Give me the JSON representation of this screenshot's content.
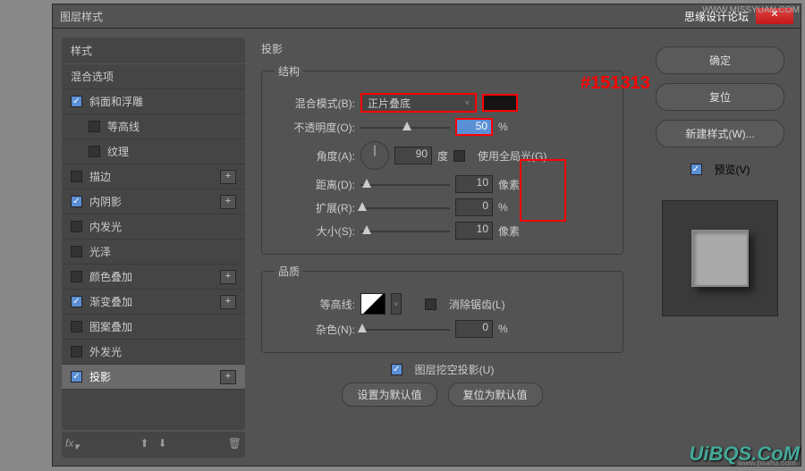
{
  "dialog": {
    "title": "图层样式",
    "tag_text": "思缘设计论坛"
  },
  "sidebar": {
    "header": "样式",
    "blend_options": "混合选项",
    "items": [
      {
        "label": "斜面和浮雕",
        "checked": true,
        "plus": false
      },
      {
        "label": "等高线",
        "checked": false,
        "sub": true
      },
      {
        "label": "纹理",
        "checked": false,
        "sub": true
      },
      {
        "label": "描边",
        "checked": false,
        "plus": true
      },
      {
        "label": "内阴影",
        "checked": true,
        "plus": true
      },
      {
        "label": "内发光",
        "checked": false
      },
      {
        "label": "光泽",
        "checked": false
      },
      {
        "label": "颜色叠加",
        "checked": false,
        "plus": true
      },
      {
        "label": "渐变叠加",
        "checked": true,
        "plus": true
      },
      {
        "label": "图案叠加",
        "checked": false
      },
      {
        "label": "外发光",
        "checked": false
      },
      {
        "label": "投影",
        "checked": true,
        "plus": true,
        "selected": true
      }
    ]
  },
  "main": {
    "title": "投影",
    "structure": {
      "legend": "结构",
      "blend_mode_label": "混合模式(B):",
      "blend_mode_value": "正片叠底",
      "color_hex": "#151313",
      "opacity_label": "不透明度(O):",
      "opacity_value": "50",
      "opacity_unit": "%",
      "angle_label": "角度(A):",
      "angle_value": "90",
      "angle_unit": "度",
      "global_light_label": "使用全局光(G)",
      "distance_label": "距离(D):",
      "distance_value": "10",
      "distance_unit": "像素",
      "spread_label": "扩展(R):",
      "spread_value": "0",
      "spread_unit": "%",
      "size_label": "大小(S):",
      "size_value": "10",
      "size_unit": "像素"
    },
    "quality": {
      "legend": "品质",
      "contour_label": "等高线:",
      "antialias_label": "消除锯齿(L)",
      "noise_label": "杂色(N):",
      "noise_value": "0",
      "noise_unit": "%"
    },
    "knockout_label": "图层挖空投影(U)",
    "make_default": "设置为默认值",
    "reset_default": "复位为默认值"
  },
  "buttons": {
    "ok": "确定",
    "cancel": "复位",
    "new_style": "新建样式(W)...",
    "preview": "预览(V)"
  },
  "watermarks": {
    "top": "WWW.MISSYUAN.COM",
    "logo": "UiBQS.CoM",
    "bottom": "www.psahz.com"
  }
}
